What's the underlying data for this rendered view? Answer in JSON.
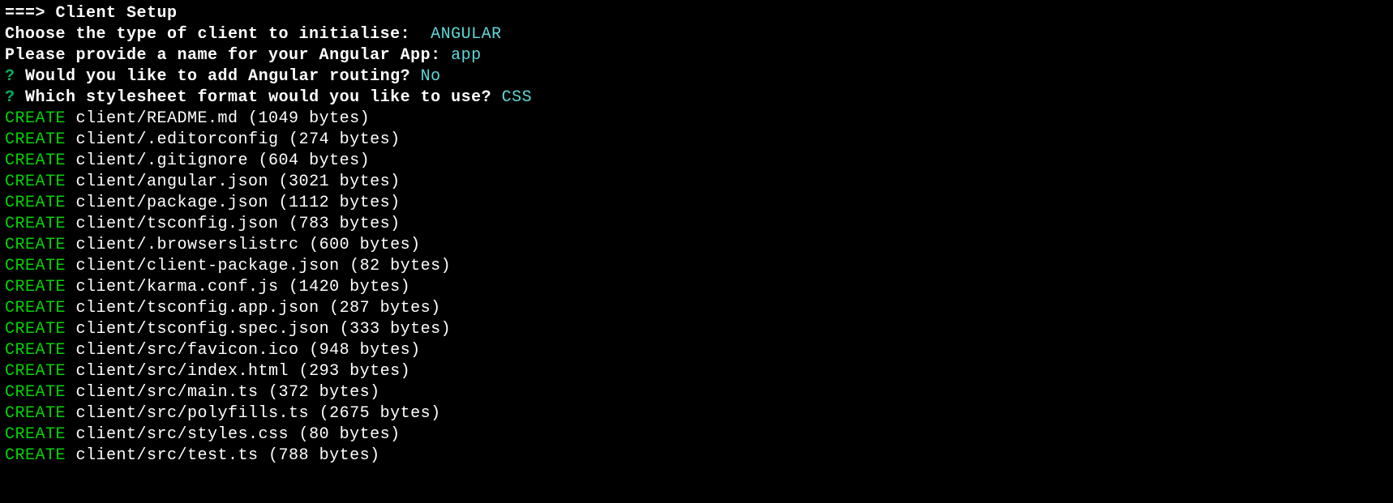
{
  "header": {
    "prefix": "===> ",
    "title": "Client Setup"
  },
  "prompts": [
    {
      "label": "Choose the type of client to initialise:  ",
      "answer": "ANGULAR"
    },
    {
      "label": "Please provide a name for your Angular App: ",
      "answer": "app"
    }
  ],
  "questions": [
    {
      "mark": "?",
      "label": " Would you like to add Angular routing? ",
      "answer": "No"
    },
    {
      "mark": "?",
      "label": " Which stylesheet format would you like to use? ",
      "answer": "CSS"
    }
  ],
  "creates": [
    {
      "verb": "CREATE",
      "file": "client/README.md",
      "bytes": 1049
    },
    {
      "verb": "CREATE",
      "file": "client/.editorconfig",
      "bytes": 274
    },
    {
      "verb": "CREATE",
      "file": "client/.gitignore",
      "bytes": 604
    },
    {
      "verb": "CREATE",
      "file": "client/angular.json",
      "bytes": 3021
    },
    {
      "verb": "CREATE",
      "file": "client/package.json",
      "bytes": 1112
    },
    {
      "verb": "CREATE",
      "file": "client/tsconfig.json",
      "bytes": 783
    },
    {
      "verb": "CREATE",
      "file": "client/.browserslistrc",
      "bytes": 600
    },
    {
      "verb": "CREATE",
      "file": "client/client-package.json",
      "bytes": 82
    },
    {
      "verb": "CREATE",
      "file": "client/karma.conf.js",
      "bytes": 1420
    },
    {
      "verb": "CREATE",
      "file": "client/tsconfig.app.json",
      "bytes": 287
    },
    {
      "verb": "CREATE",
      "file": "client/tsconfig.spec.json",
      "bytes": 333
    },
    {
      "verb": "CREATE",
      "file": "client/src/favicon.ico",
      "bytes": 948
    },
    {
      "verb": "CREATE",
      "file": "client/src/index.html",
      "bytes": 293
    },
    {
      "verb": "CREATE",
      "file": "client/src/main.ts",
      "bytes": 372
    },
    {
      "verb": "CREATE",
      "file": "client/src/polyfills.ts",
      "bytes": 2675
    },
    {
      "verb": "CREATE",
      "file": "client/src/styles.css",
      "bytes": 80
    },
    {
      "verb": "CREATE",
      "file": "client/src/test.ts",
      "bytes": 788
    }
  ]
}
